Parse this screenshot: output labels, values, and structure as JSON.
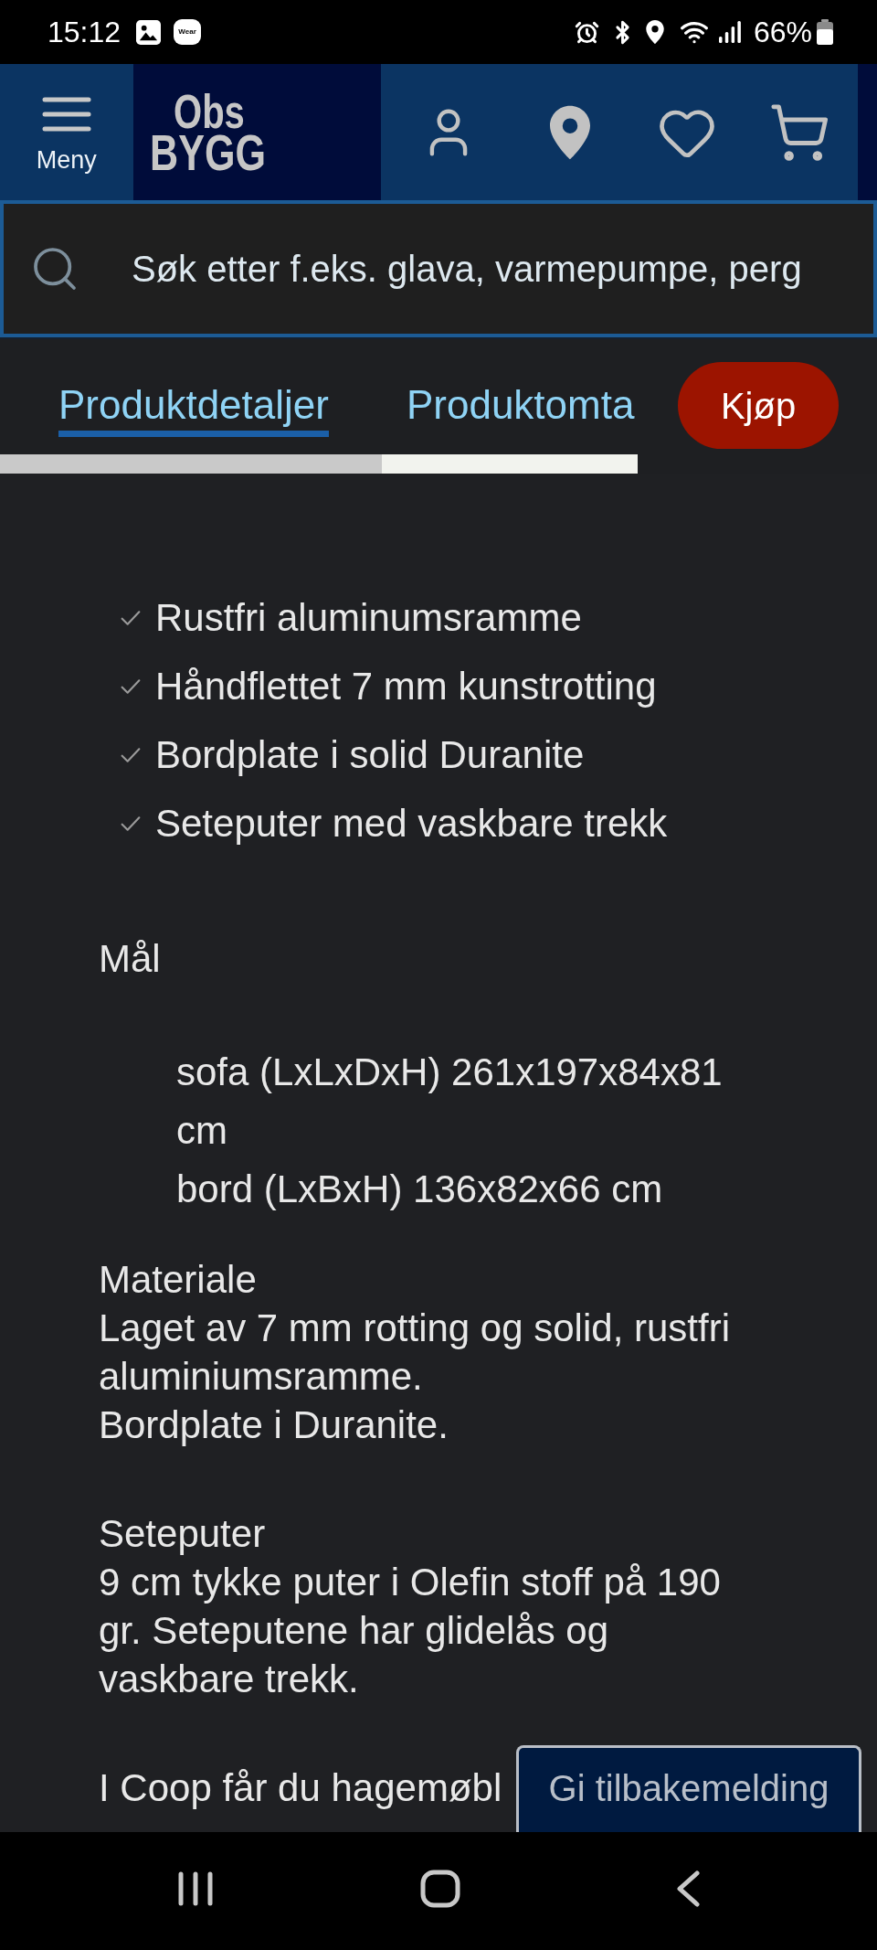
{
  "status_bar": {
    "time": "15:12",
    "notification_badge": "Wear",
    "battery": "66%"
  },
  "header": {
    "menu_label": "Meny",
    "logo": [
      "Obs",
      "BYGG"
    ]
  },
  "search": {
    "placeholder": "Søk etter f.eks. glava, varmepumpe, perg"
  },
  "tabs": [
    {
      "label": "Produktdetaljer",
      "selected": true
    },
    {
      "label": "Produktomta",
      "selected": false
    }
  ],
  "buy_button": "Kjøp",
  "features": [
    "Rustfri aluminumsramme",
    "Håndflettet 7 mm kunstrotting",
    "Bordplate i solid Duranite",
    "Seteputer med vaskbare trekk"
  ],
  "dimensions": {
    "title": "Mål",
    "items": [
      "sofa (LxLxDxH) 261x197x84x81 cm",
      "bord (LxBxH) 136x82x66 cm"
    ]
  },
  "sections": [
    {
      "title": "Materiale",
      "lines": [
        "Laget av 7 mm rotting og solid, rustfri aluminiumsramme.",
        "Bordplate i Duranite."
      ]
    },
    {
      "title": "Seteputer",
      "lines": [
        "9 cm tykke puter i Olefin stoff på 190 gr. Seteputene har glidelås og vaskbare trekk."
      ]
    }
  ],
  "intro_text": "I Coop får du hagemøbl",
  "feedback_button": "Gi tilbakemelding"
}
